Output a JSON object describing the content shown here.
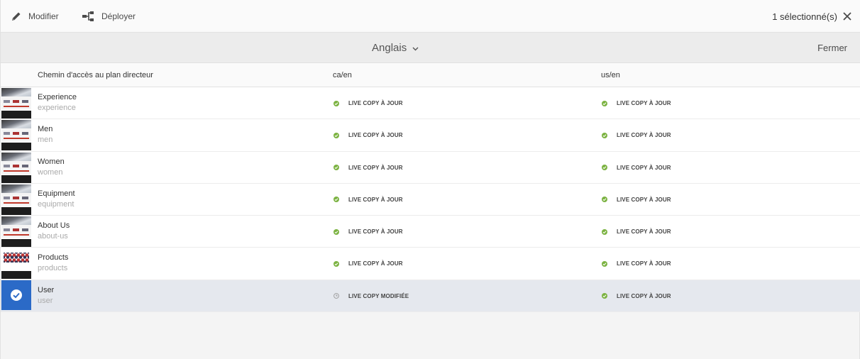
{
  "toolbar": {
    "edit_label": "Modifier",
    "deploy_label": "Déployer",
    "selection_count": "1 sélectionné(s)",
    "icons": {
      "edit": "pencil-icon",
      "deploy": "rollout-icon",
      "close": "close-icon"
    }
  },
  "language_bar": {
    "language": "Anglais",
    "close_label": "Fermer",
    "icons": {
      "dropdown": "chevron-down-icon"
    }
  },
  "table": {
    "headers": {
      "blueprint_path": "Chemin d'accès au plan directeur",
      "col1": "ca/en",
      "col2": "us/en"
    },
    "rows": [
      {
        "title": "Experience",
        "path": "experience",
        "ca": "LIVE COPY À JOUR",
        "ca_state": "up-to-date",
        "us": "LIVE COPY À JOUR",
        "us_state": "up-to-date",
        "selected": false
      },
      {
        "title": "Men",
        "path": "men",
        "ca": "LIVE COPY À JOUR",
        "ca_state": "up-to-date",
        "us": "LIVE COPY À JOUR",
        "us_state": "up-to-date",
        "selected": false
      },
      {
        "title": "Women",
        "path": "women",
        "ca": "LIVE COPY À JOUR",
        "ca_state": "up-to-date",
        "us": "LIVE COPY À JOUR",
        "us_state": "up-to-date",
        "selected": false
      },
      {
        "title": "Equipment",
        "path": "equipment",
        "ca": "LIVE COPY À JOUR",
        "ca_state": "up-to-date",
        "us": "LIVE COPY À JOUR",
        "us_state": "up-to-date",
        "selected": false
      },
      {
        "title": "About Us",
        "path": "about-us",
        "ca": "LIVE COPY À JOUR",
        "ca_state": "up-to-date",
        "us": "LIVE COPY À JOUR",
        "us_state": "up-to-date",
        "selected": false
      },
      {
        "title": "Products",
        "path": "products",
        "ca": "LIVE COPY À JOUR",
        "ca_state": "up-to-date",
        "us": "LIVE COPY À JOUR",
        "us_state": "up-to-date",
        "selected": false
      },
      {
        "title": "User",
        "path": "user",
        "ca": "LIVE COPY MODIFIÉE",
        "ca_state": "modified",
        "us": "LIVE COPY À JOUR",
        "us_state": "up-to-date",
        "selected": true
      }
    ]
  },
  "colors": {
    "accent": "#2b6ac7",
    "status_ok": "#7cb342",
    "status_modified": "#999999",
    "selected_row": "#e5e8ee"
  }
}
